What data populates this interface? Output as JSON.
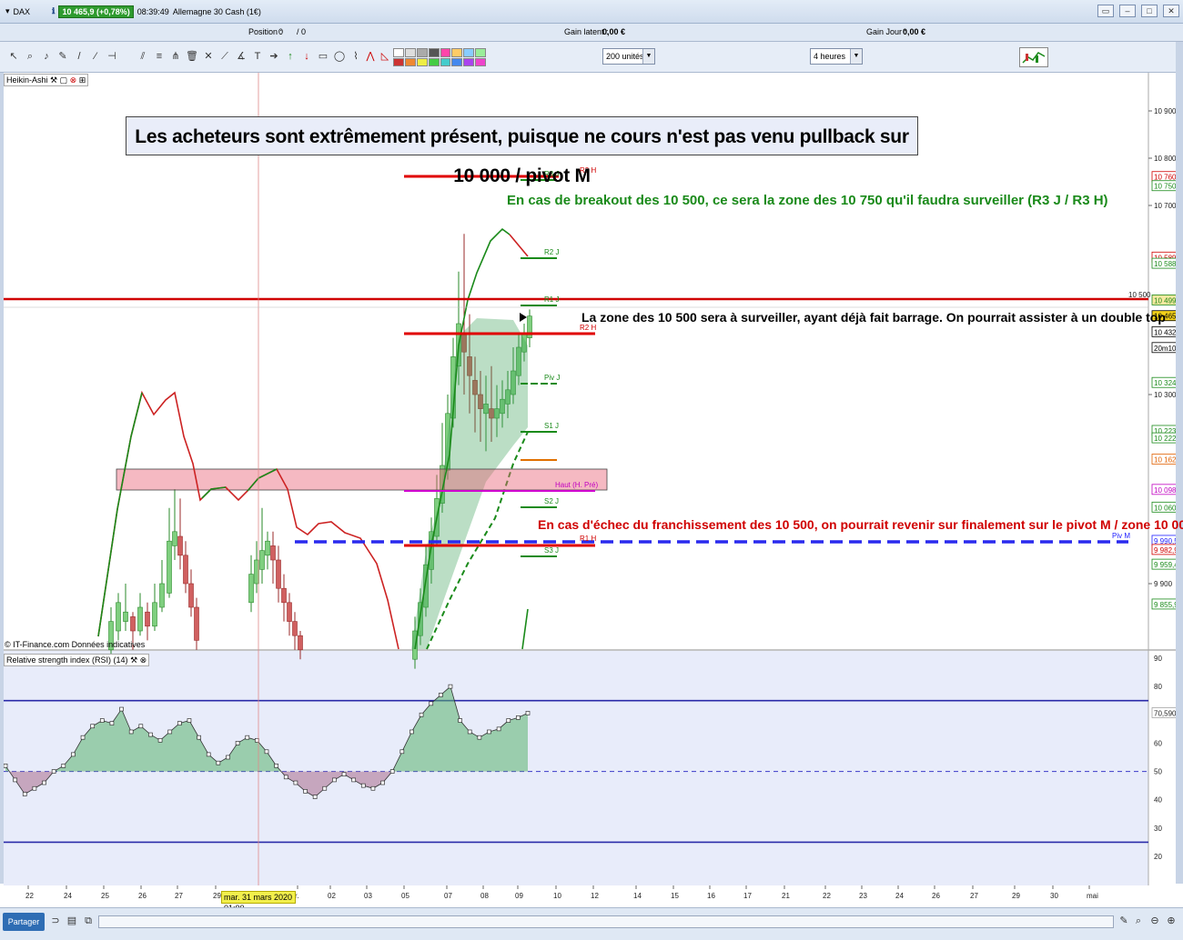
{
  "window": {
    "symbol": "DAX",
    "price_badge": "10 465,9 (+0,78%)",
    "time": "08:39:49",
    "instrument": "Allemagne 30 Cash (1€)"
  },
  "info": {
    "position_label": "Position :",
    "position_value": "0",
    "position_sep": "/ 0",
    "gain_latent_label": "Gain latent :",
    "gain_latent_value": "0,00 €",
    "gain_jour_label": "Gain Jour :",
    "gain_jour_value": "0,00 €"
  },
  "toolbar": {
    "units_select": "200 unités",
    "timeframe_select": "4 heures"
  },
  "chart_label": "Heikin-Ashi",
  "rsi_label": "Relative strength index (RSI) (14)",
  "credit": "© IT-Finance.com  Données indicatives",
  "cursor_date": "mar. 31 mars 2020 01:00",
  "share_button": "Partager",
  "annotations": {
    "main": "Les acheteurs sont extrêmement présent, puisque ne cours n'est pas venu pullback sur 10 000 / pivot M",
    "breakout": "En cas de breakout des 10 500, ce sera la zone des 10 750 qu'il faudra surveiller (R3 J / R3 H)",
    "zone10500": "La zone des 10 500 sera à surveiller, ayant déjà fait barrage. On pourrait assister à un double top",
    "fail": "En cas d'échec du franchissement des 10 500, on pourrait revenir sur finalement sur le pivot M / zone 10 000"
  },
  "level_labels": {
    "r3h": "R3 H",
    "r3j": "R3 J",
    "r2j": "R2 J",
    "r1j": "R1 J",
    "r2h": "R2 H",
    "pivj": "Piv J",
    "s1j": "S1 J",
    "haut": "Haut (H. Pré)",
    "s2j": "S2 J",
    "r1h": "R1 H",
    "s3j": "S3 J",
    "pivm": "Piv M",
    "l10500": "10 500"
  },
  "price_axis": {
    "ticks": [
      "10 900",
      "10 800",
      "10 700",
      "10 300",
      "9 900"
    ],
    "tags": [
      {
        "text": "10 760,1",
        "color": "#d00000"
      },
      {
        "text": "10 750,5",
        "color": "#1a8a1a"
      },
      {
        "text": "10 589,8",
        "color": "#d00000"
      },
      {
        "text": "10 588,3",
        "color": "#1a8a1a"
      },
      {
        "text": "10 499,2",
        "color": "#1a8a1a"
      },
      {
        "text": "10 465,9",
        "color": "#000000"
      },
      {
        "text": "10 432,0",
        "color": "#000000"
      },
      {
        "text": "20m10s",
        "color": "#000000"
      },
      {
        "text": "10 324,6",
        "color": "#1a8a1a"
      },
      {
        "text": "10 223,1",
        "color": "#1a8a1a"
      },
      {
        "text": "10 222,9",
        "color": "#1a8a1a"
      },
      {
        "text": "10 162,5",
        "color": "#e06000"
      },
      {
        "text": "10 098,4",
        "color": "#c000c0"
      },
      {
        "text": "10 060,9",
        "color": "#1a8a1a"
      },
      {
        "text": "9 990,5",
        "color": "#2020ff"
      },
      {
        "text": "9 982,9",
        "color": "#d00000"
      },
      {
        "text": "9 959,4",
        "color": "#1a8a1a"
      },
      {
        "text": "9 855,9",
        "color": "#1a8a1a"
      }
    ]
  },
  "rsi_axis": {
    "ticks": [
      "90",
      "80",
      "70,590",
      "60",
      "50",
      "40",
      "30",
      "20"
    ]
  },
  "date_axis": [
    "22",
    "24",
    "25",
    "26",
    "27",
    "29",
    "r.",
    "02",
    "03",
    "05",
    "07",
    "08",
    "09",
    "10",
    "12",
    "14",
    "15",
    "16",
    "17",
    "21",
    "22",
    "23",
    "24",
    "26",
    "27",
    "29",
    "30",
    "mai"
  ],
  "chart_data": {
    "type": "line",
    "series": [
      {
        "name": "RSI (14)",
        "values": [
          52,
          47,
          42,
          44,
          46,
          50,
          52,
          56,
          62,
          66,
          68,
          67,
          72,
          64,
          66,
          63,
          61,
          64,
          67,
          68,
          62,
          56,
          53,
          55,
          60,
          62,
          61,
          57,
          52,
          48,
          46,
          43,
          41,
          44,
          47,
          49,
          47,
          45,
          44,
          46,
          50,
          57,
          64,
          70,
          74,
          77,
          80,
          68,
          64,
          62,
          64,
          65,
          68,
          69,
          70.6
        ]
      }
    ],
    "levels": [
      75,
      50,
      25
    ],
    "ylim": [
      20,
      90
    ]
  }
}
